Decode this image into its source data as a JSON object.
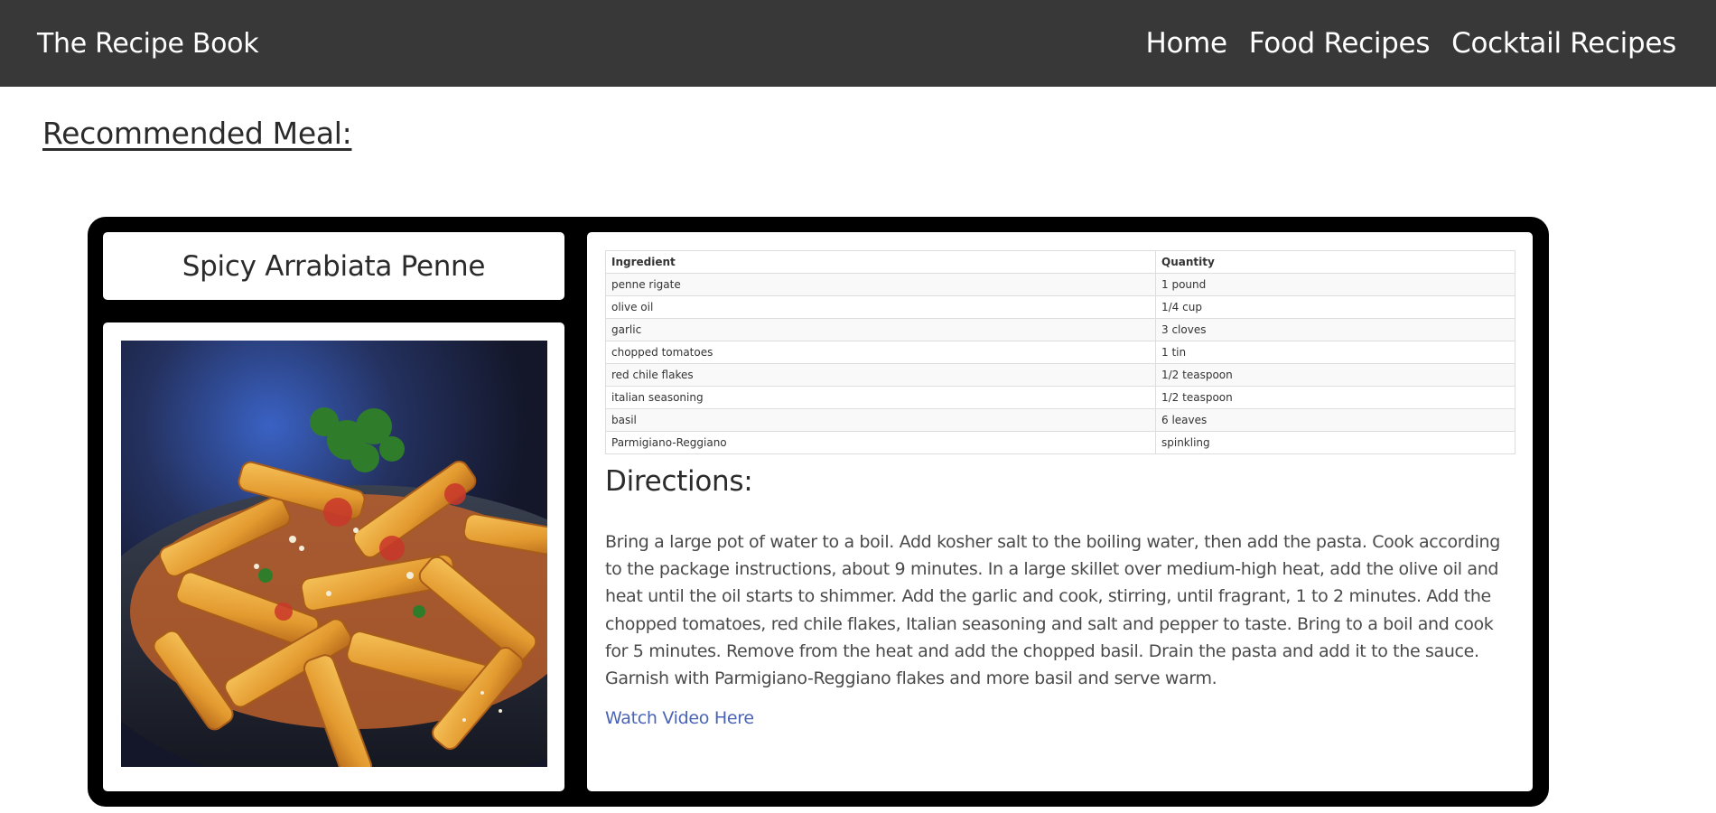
{
  "navbar": {
    "brand": "The Recipe Book",
    "links": [
      "Home",
      "Food Recipes",
      "Cocktail Recipes"
    ]
  },
  "section_title": "Recommended Meal:",
  "recipe": {
    "title": "Spicy Arrabiata Penne",
    "image_alt": "Spicy Arrabiata Penne",
    "table_headers": [
      "Ingredient",
      "Quantity"
    ],
    "ingredients": [
      [
        "penne rigate",
        "1 pound"
      ],
      [
        "olive oil",
        "1/4 cup"
      ],
      [
        "garlic",
        "3 cloves"
      ],
      [
        "chopped tomatoes",
        "1 tin"
      ],
      [
        "red chile flakes",
        "1/2 teaspoon"
      ],
      [
        "italian seasoning",
        "1/2 teaspoon"
      ],
      [
        "basil",
        "6 leaves"
      ],
      [
        "Parmigiano-Reggiano",
        "spinkling"
      ]
    ],
    "directions_heading": "Directions:",
    "directions": "Bring a large pot of water to a boil. Add kosher salt to the boiling water, then add the pasta. Cook according to the package instructions, about 9 minutes. In a large skillet over medium-high heat, add the olive oil and heat until the oil starts to shimmer. Add the garlic and cook, stirring, until fragrant, 1 to 2 minutes. Add the chopped tomatoes, red chile flakes, Italian seasoning and salt and pepper to taste. Bring to a boil and cook for 5 minutes. Remove from the heat and add the chopped basil. Drain the pasta and add it to the sauce. Garnish with Parmigiano-Reggiano flakes and more basil and serve warm.",
    "video_link": "Watch Video Here"
  },
  "colors": {
    "navbar_bg": "#383838",
    "card_frame": "#000000",
    "link": "#4a63b5"
  }
}
